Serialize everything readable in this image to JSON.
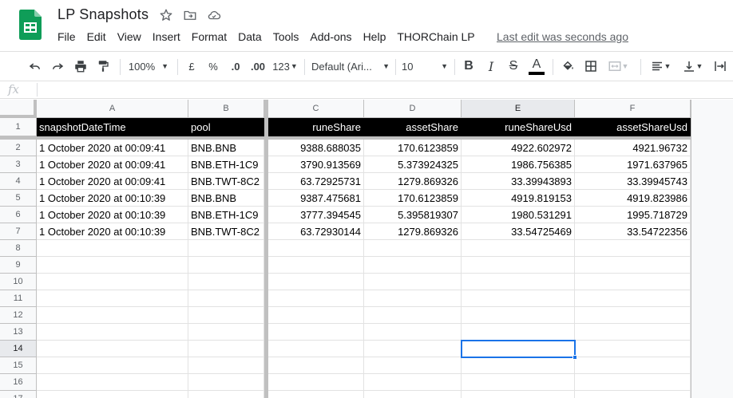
{
  "app": {
    "doc_title": "LP Snapshots",
    "last_edit": "Last edit was seconds ago",
    "brand_color": "#0f9d58"
  },
  "menu": [
    "File",
    "Edit",
    "View",
    "Insert",
    "Format",
    "Data",
    "Tools",
    "Add-ons",
    "Help",
    "THORChain LP"
  ],
  "toolbar": {
    "zoom": "100%",
    "currency": "£",
    "percent": "%",
    "decrease_decimals": ".0",
    "increase_decimals": ".00",
    "more_formats": "123",
    "font_family": "Default (Ari...",
    "font_size": "10",
    "bold": "B",
    "italic": "I",
    "strikethrough": "S",
    "text_color": "A"
  },
  "formula_bar": {
    "fx_label": "fx",
    "value": ""
  },
  "columns": [
    "A",
    "B",
    "C",
    "D",
    "E",
    "F"
  ],
  "selected_column": "E",
  "selected_row": "14",
  "row_numbers": [
    "1",
    "2",
    "3",
    "4",
    "5",
    "6",
    "7",
    "8",
    "9",
    "10",
    "11",
    "12",
    "13",
    "14",
    "15",
    "16",
    "17"
  ],
  "sheet": {
    "headers": [
      "snapshotDateTime",
      "pool",
      "runeShare",
      "assetShare",
      "runeShareUsd",
      "assetShareUsd"
    ],
    "rows": [
      [
        "1 October 2020 at 00:09:41",
        "BNB.BNB",
        "9388.688035",
        "170.6123859",
        "4922.602972",
        "4921.96732"
      ],
      [
        "1 October 2020 at 00:09:41",
        "BNB.ETH-1C9",
        "3790.913569",
        "5.373924325",
        "1986.756385",
        "1971.637965"
      ],
      [
        "1 October 2020 at 00:09:41",
        "BNB.TWT-8C2",
        "63.72925731",
        "1279.869326",
        "33.39943893",
        "33.39945743"
      ],
      [
        "1 October 2020 at 00:10:39",
        "BNB.BNB",
        "9387.475681",
        "170.6123859",
        "4919.819153",
        "4919.823986"
      ],
      [
        "1 October 2020 at 00:10:39",
        "BNB.ETH-1C9",
        "3777.394545",
        "5.395819307",
        "1980.531291",
        "1995.718729"
      ],
      [
        "1 October 2020 at 00:10:39",
        "BNB.TWT-8C2",
        "63.72930144",
        "1279.869326",
        "33.54725469",
        "33.54722356"
      ]
    ]
  }
}
